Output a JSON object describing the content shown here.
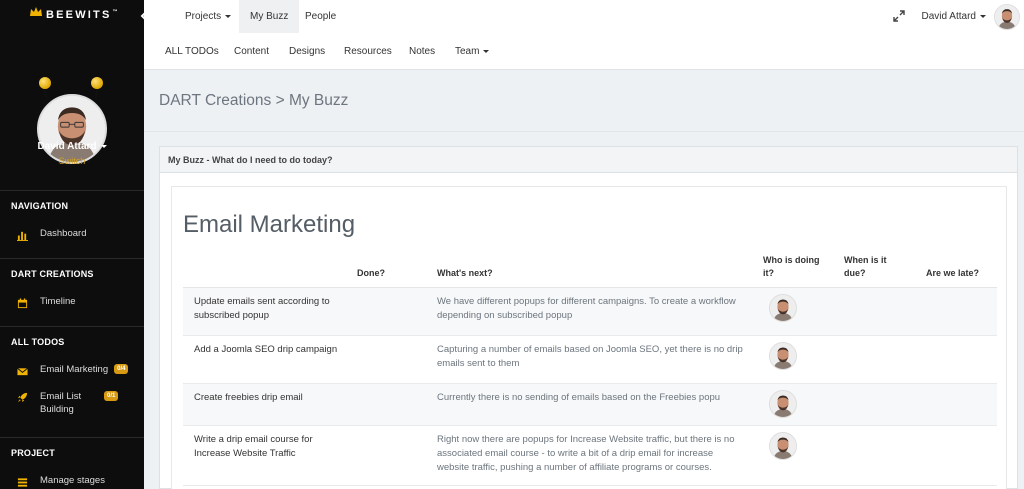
{
  "brand": {
    "name": "BEEWITS",
    "tm": "™",
    "accent": "#f0b400"
  },
  "sidebar": {
    "profile": {
      "name": "David Attard",
      "switch_label": "Switch"
    },
    "sections": [
      {
        "heading": "NAVIGATION",
        "items": [
          {
            "label": "Dashboard",
            "icon": "bar-chart-icon"
          }
        ]
      },
      {
        "heading": "DART CREATIONS",
        "items": [
          {
            "label": "Timeline",
            "icon": "calendar-icon"
          }
        ]
      },
      {
        "heading": "ALL TODOS",
        "items": [
          {
            "label": "Email Marketing",
            "icon": "envelope-icon",
            "badge": "0/4"
          },
          {
            "label": "Email List Building",
            "icon": "rocket-icon",
            "badge": "0/1"
          }
        ]
      },
      {
        "heading": "PROJECT",
        "items": [
          {
            "label": "Manage stages",
            "icon": "stages-icon"
          }
        ]
      }
    ]
  },
  "topnav": {
    "primary": [
      "Projects",
      "My Buzz",
      "People"
    ],
    "active": "My Buzz",
    "secondary": [
      "ALL TODOs",
      "Content",
      "Designs",
      "Resources",
      "Notes",
      "Team"
    ],
    "user_name": "David Attard"
  },
  "breadcrumb": "DART Creations > My Buzz",
  "panel": {
    "heading": "My Buzz - What do I need to do today?"
  },
  "todo_list": {
    "title": "Email Marketing",
    "columns": [
      "Done?",
      "What's next?",
      "Who is doing it?",
      "When is it due?",
      "Are we late?"
    ],
    "rows": [
      {
        "task": "Update emails sent according to subscribed popup",
        "next": "We have different popups for different campaigns. To create a workflow depending on subscribed popup"
      },
      {
        "task": "Add a Joomla SEO drip campaign",
        "next": "Capturing a number of emails based on Joomla SEO, yet there is no drip emails sent to them"
      },
      {
        "task": "Create freebies drip email",
        "next": "Currently there is no sending of emails based on the Freebies popu"
      },
      {
        "task": "Write a drip email course for Increase Website Traffic",
        "next": "Right now there are popups for Increase Website traffic, but there is no associated email course - to write a bit of a drip email for increase website traffic, pushing a number of affiliate programs or courses."
      }
    ]
  }
}
